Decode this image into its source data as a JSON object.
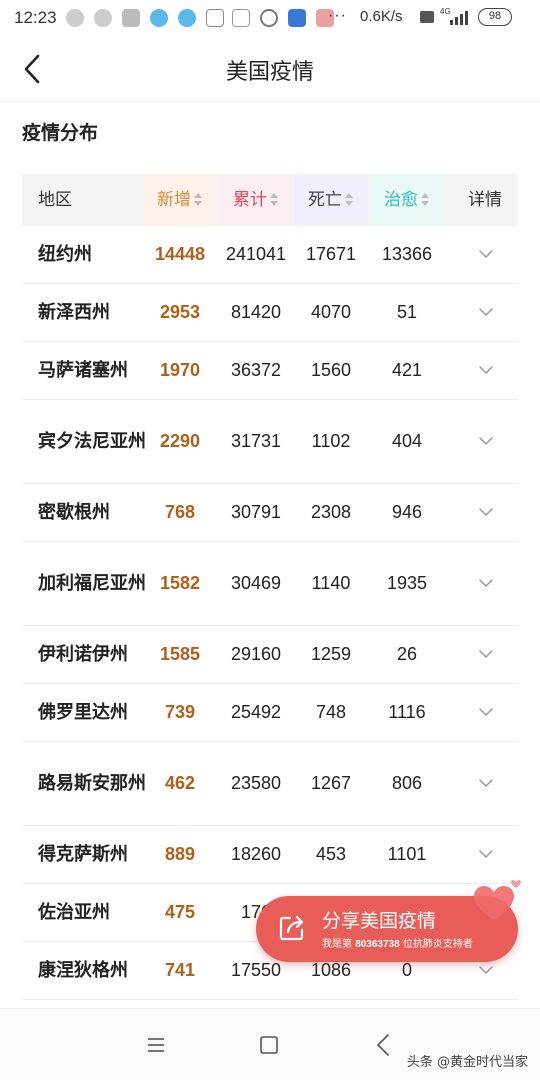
{
  "status_bar": {
    "time": "12:23",
    "dots": "···",
    "speed": "0.6K/s",
    "battery": "98",
    "network": "4G",
    "icons": [
      "wechat-icon",
      "wechat-icon",
      "app-icon",
      "app-icon",
      "app-icon",
      "calendar-icon",
      "alipay-icon",
      "app-icon",
      "app-icon",
      "app-icon"
    ]
  },
  "header": {
    "title": "美国疫情"
  },
  "section": {
    "title": "疫情分布"
  },
  "table": {
    "headers": {
      "region": "地区",
      "new": "新增",
      "total": "累计",
      "death": "死亡",
      "cured": "治愈",
      "detail": "详情"
    },
    "rows": [
      {
        "region": "纽约州",
        "new": "14448",
        "total": "241041",
        "death": "17671",
        "cured": "13366"
      },
      {
        "region": "新泽西州",
        "new": "2953",
        "total": "81420",
        "death": "4070",
        "cured": "51"
      },
      {
        "region": "马萨诸塞州",
        "new": "1970",
        "total": "36372",
        "death": "1560",
        "cured": "421"
      },
      {
        "region": "宾夕法尼亚州",
        "new": "2290",
        "total": "31731",
        "death": "1102",
        "cured": "404"
      },
      {
        "region": "密歇根州",
        "new": "768",
        "total": "30791",
        "death": "2308",
        "cured": "946"
      },
      {
        "region": "加利福尼亚州",
        "new": "1582",
        "total": "30469",
        "death": "1140",
        "cured": "1935"
      },
      {
        "region": "伊利诺伊州",
        "new": "1585",
        "total": "29160",
        "death": "1259",
        "cured": "26"
      },
      {
        "region": "佛罗里达州",
        "new": "739",
        "total": "25492",
        "death": "748",
        "cured": "1116"
      },
      {
        "region": "路易斯安那州",
        "new": "462",
        "total": "23580",
        "death": "1267",
        "cured": "806"
      },
      {
        "region": "得克萨斯州",
        "new": "889",
        "total": "18260",
        "death": "453",
        "cured": "1101"
      },
      {
        "region": "佐治亚州",
        "new": "475",
        "total": "176",
        "death": "",
        "cured": ""
      },
      {
        "region": "康涅狄格州",
        "new": "741",
        "total": "17550",
        "death": "1086",
        "cured": "0"
      }
    ]
  },
  "share": {
    "title": "分享美国疫情",
    "sub_prefix": "我是第",
    "sub_number": "80363738",
    "sub_suffix": "位抗肺炎支持者"
  },
  "watermark": "头条 @黄金时代当家",
  "colors": {
    "new": "#b0601a",
    "total_header": "#e0475c",
    "cured_header": "#2dc0b6",
    "share_button": "#e85d57"
  }
}
